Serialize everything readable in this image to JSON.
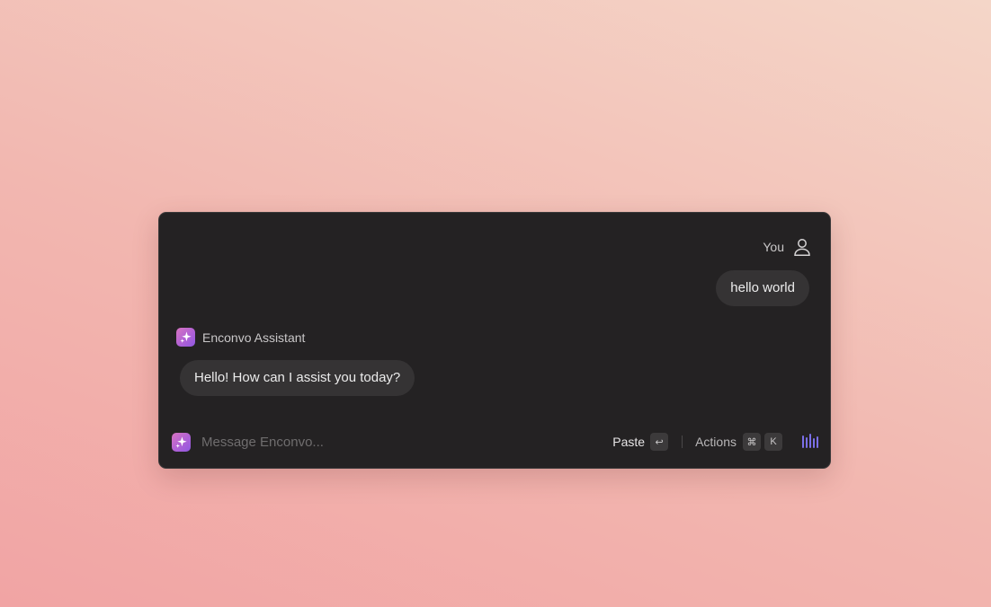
{
  "conversation": {
    "user": {
      "name": "You",
      "icon": "person-icon",
      "message": "hello world"
    },
    "assistant": {
      "name": "Enconvo Assistant",
      "icon": "sparkle-icon",
      "message": "Hello! How can I assist you today?"
    }
  },
  "composer": {
    "placeholder": "Message Enconvo...",
    "value": "",
    "paste": {
      "label": "Paste",
      "key": "↩",
      "key_icon": "return-key-icon"
    },
    "actions": {
      "label": "Actions",
      "keys": [
        "⌘",
        "K"
      ]
    },
    "voice_icon": "audio-waveform-icon"
  },
  "colors": {
    "accent_gradient": [
      "#d774c0",
      "#8f58e0"
    ],
    "voice_bars": "#7b6fe8",
    "window_background": "#242223",
    "bubble_background": "#353334"
  }
}
